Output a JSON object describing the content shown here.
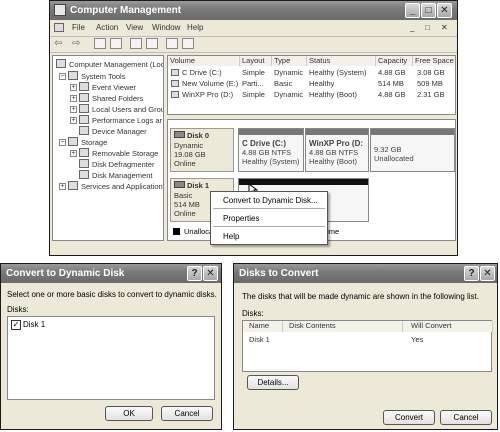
{
  "main_window": {
    "title": "Computer Management",
    "menu": [
      "File",
      "Action",
      "View",
      "Window",
      "Help"
    ],
    "tree": {
      "root": "Computer Management (Loc",
      "system_tools": "System Tools",
      "event_viewer": "Event Viewer",
      "shared_folders": "Shared Folders",
      "local_users": "Local Users and Grou",
      "perf_logs": "Performance Logs ar",
      "device_manager": "Device Manager",
      "storage": "Storage",
      "removable_storage": "Removable Storage",
      "disk_defrag": "Disk Defragmenter",
      "disk_mgmt": "Disk Management",
      "services": "Services and Applications"
    },
    "volume_columns": [
      "Volume",
      "Layout",
      "Type",
      "Status",
      "Capacity",
      "Free Space"
    ],
    "volumes": [
      [
        "C Drive (C:)",
        "Simple",
        "Dynamic",
        "Healthy (System)",
        "4.88 GB",
        "3.08 GB"
      ],
      [
        "New Volume (E:)",
        "Parti...",
        "Basic",
        "Healthy",
        "514 MB",
        "509 MB"
      ],
      [
        "WinXP Pro (D:)",
        "Simple",
        "Dynamic",
        "Healthy (Boot)",
        "4.88 GB",
        "2.31 GB"
      ]
    ],
    "disk0": {
      "name": "Disk 0",
      "type": "Dynamic",
      "size": "19.08 GB",
      "status": "Online",
      "p1_name": "C Drive  (C:)",
      "p1_size": "4.88 GB NTFS",
      "p1_status": "Healthy (System)",
      "p2_name": "WinXP Pro  (D:",
      "p2_size": "4.88 GB NTFS",
      "p2_status": "Healthy (Boot)",
      "p3_size": "9.32 GB",
      "p3_status": "Unallocated"
    },
    "disk1": {
      "name": "Disk 1",
      "type": "Basic",
      "size": "514 MB",
      "status": "Online"
    },
    "legend_unalloc": "Unalloca",
    "legend_volume": "volume",
    "context_menu": [
      "Convert to Dynamic Disk...",
      "Properties",
      "Help"
    ]
  },
  "convert_dialog": {
    "title": "Convert to Dynamic Disk",
    "instruction": "Select one or more basic disks to convert to dynamic disks.",
    "disks_label": "Disks:",
    "disk_item": "Disk 1",
    "ok": "OK",
    "cancel": "Cancel"
  },
  "disks_dialog": {
    "title": "Disks to Convert",
    "instruction": "The disks that will be made dynamic are shown in the following list.",
    "disks_label": "Disks:",
    "columns": [
      "Name",
      "Disk Contents",
      "Will Convert"
    ],
    "row": [
      "Disk 1",
      "",
      "Yes"
    ],
    "details": "Details...",
    "convert": "Convert",
    "cancel": "Cancel"
  }
}
